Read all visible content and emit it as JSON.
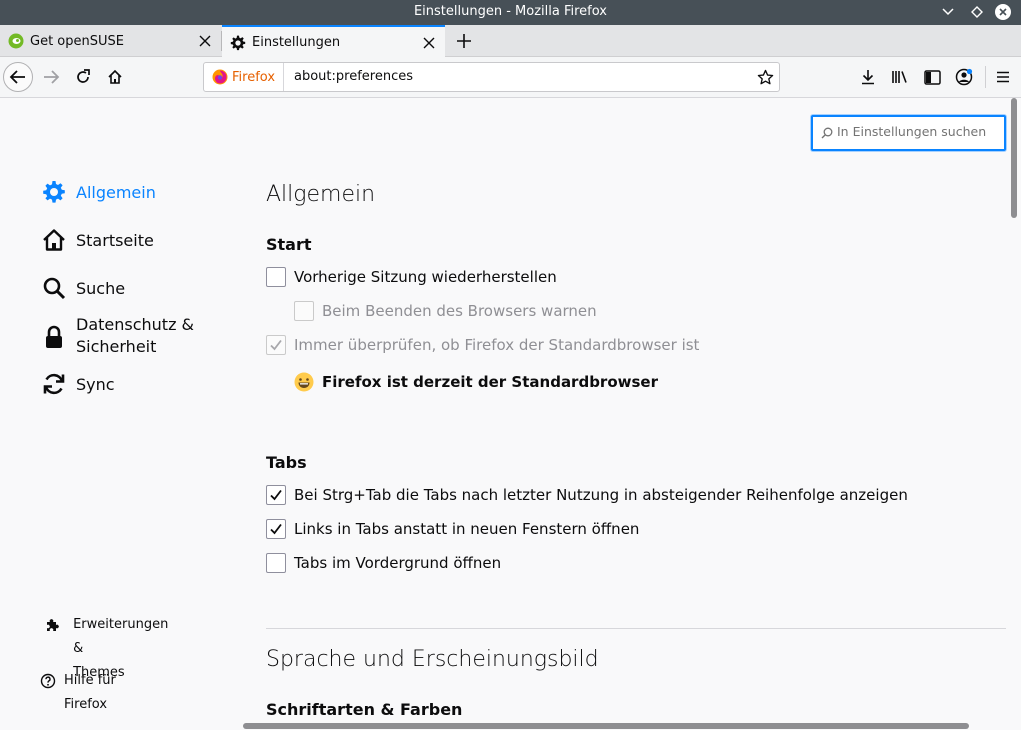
{
  "window": {
    "title": "Einstellungen - Mozilla Firefox",
    "buttons": [
      "chevron-down-icon",
      "diamond-icon",
      "close-icon"
    ]
  },
  "tabs": [
    {
      "label": "Get openSUSE",
      "icon": "opensuse-icon",
      "active": false
    },
    {
      "label": "Einstellungen",
      "icon": "gear-icon",
      "active": true
    }
  ],
  "navbar": {
    "identity_label": "Firefox",
    "url": "about:preferences"
  },
  "search": {
    "placeholder": "In Einstellungen suchen"
  },
  "sidebar": {
    "categories": [
      {
        "label": "Allgemein",
        "icon": "gear-icon",
        "selected": true
      },
      {
        "label": "Startseite",
        "icon": "home-icon",
        "selected": false
      },
      {
        "label": "Suche",
        "icon": "search-icon",
        "selected": false
      },
      {
        "label_line1": "Datenschutz &",
        "label_line2": "Sicherheit",
        "icon": "lock-icon",
        "selected": false
      },
      {
        "label": "Sync",
        "icon": "sync-icon",
        "selected": false
      }
    ],
    "footer": [
      {
        "label_line1": "Erweiterungen &",
        "label_line2": "Themes",
        "icon": "puzzle-icon"
      },
      {
        "label": "Hilfe für Firefox",
        "icon": "help-icon"
      }
    ]
  },
  "main": {
    "heading": "Allgemein",
    "start": {
      "heading": "Start",
      "restore_session": {
        "label": "Vorherige Sitzung wiederherstellen",
        "checked": false
      },
      "warn_on_quit": {
        "label": "Beim Beenden des Browsers warnen",
        "checked": false,
        "disabled": true
      },
      "check_default": {
        "label": "Immer überprüfen, ob Firefox der Standardbrowser ist",
        "checked": true,
        "disabled": true
      },
      "is_default_text": "Firefox ist derzeit der Standardbrowser"
    },
    "tabs_section": {
      "heading": "Tabs",
      "ctrl_tab": {
        "label": "Bei Strg+Tab die Tabs nach letzter Nutzung in absteigender Reihenfolge anzeigen",
        "checked": true
      },
      "links_in_tabs": {
        "label": "Links in Tabs anstatt in neuen Fenstern öffnen",
        "checked": true
      },
      "foreground": {
        "label": "Tabs im Vordergrund öffnen",
        "checked": false
      }
    },
    "language": {
      "heading": "Sprache und Erscheinungsbild",
      "fonts_heading": "Schriftarten & Farben"
    }
  },
  "colors": {
    "accent": "#0a84ff",
    "titlebar": "#475057"
  }
}
